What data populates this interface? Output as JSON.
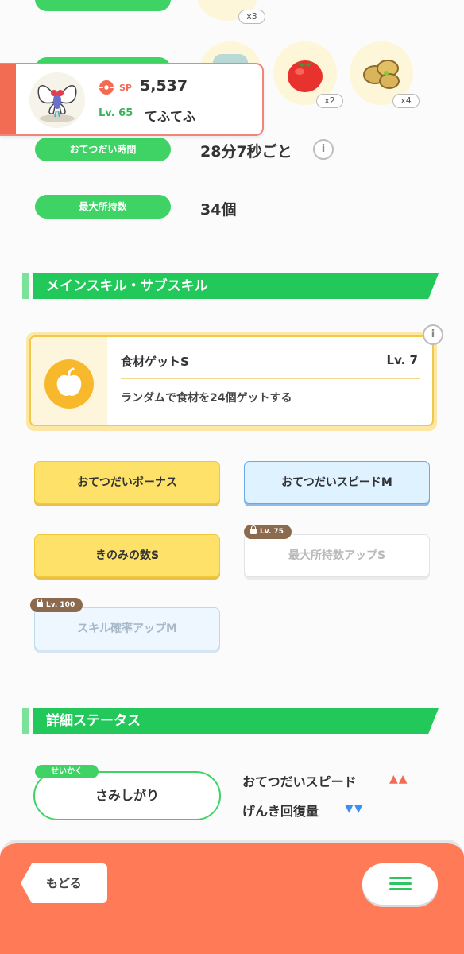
{
  "ingredients": {
    "top_count": "x3",
    "counts": [
      "x2",
      "x4"
    ]
  },
  "profile": {
    "sp_label": "SP",
    "sp_value": "5,537",
    "level": "Lv. 65",
    "nickname": "てふてふ"
  },
  "stats": {
    "help_time_label": "おてつだい時間",
    "help_time_value": "28分7秒ごと",
    "max_carry_label": "最大所持数",
    "max_carry_value": "34個"
  },
  "skills_section": {
    "title": "メインスキル・サブスキル",
    "main_skill": {
      "name": "食材ゲットS",
      "level": "Lv. 7",
      "description": "ランダムで食材を24個ゲットする"
    },
    "sub_skills": [
      {
        "label": "おてつだいボーナス",
        "locked": false
      },
      {
        "label": "おてつだいスピードM",
        "locked": false
      },
      {
        "label": "きのみの数S",
        "locked": false
      },
      {
        "label": "最大所持数アップS",
        "locked": true,
        "unlock_level": "Lv. 75"
      },
      {
        "label": "スキル確率アップM",
        "locked": true,
        "unlock_level": "Lv. 100"
      }
    ]
  },
  "details_section": {
    "title": "詳細ステータス",
    "nature_tag": "せいかく",
    "nature": "さみしがり",
    "effects": [
      {
        "label": "おてつだいスピード",
        "arrows": "▲▲",
        "color": "#f26b53"
      },
      {
        "label": "げんき回復量",
        "arrows": "▼▼",
        "color": "#3b8ff0"
      }
    ]
  },
  "footer": {
    "back_label": "もどる"
  },
  "colors": {
    "accent_green": "#22c95a",
    "accent_orange": "#ff7a56",
    "skill_yellow": "#fde168",
    "skill_blue": "#dff2ff"
  }
}
